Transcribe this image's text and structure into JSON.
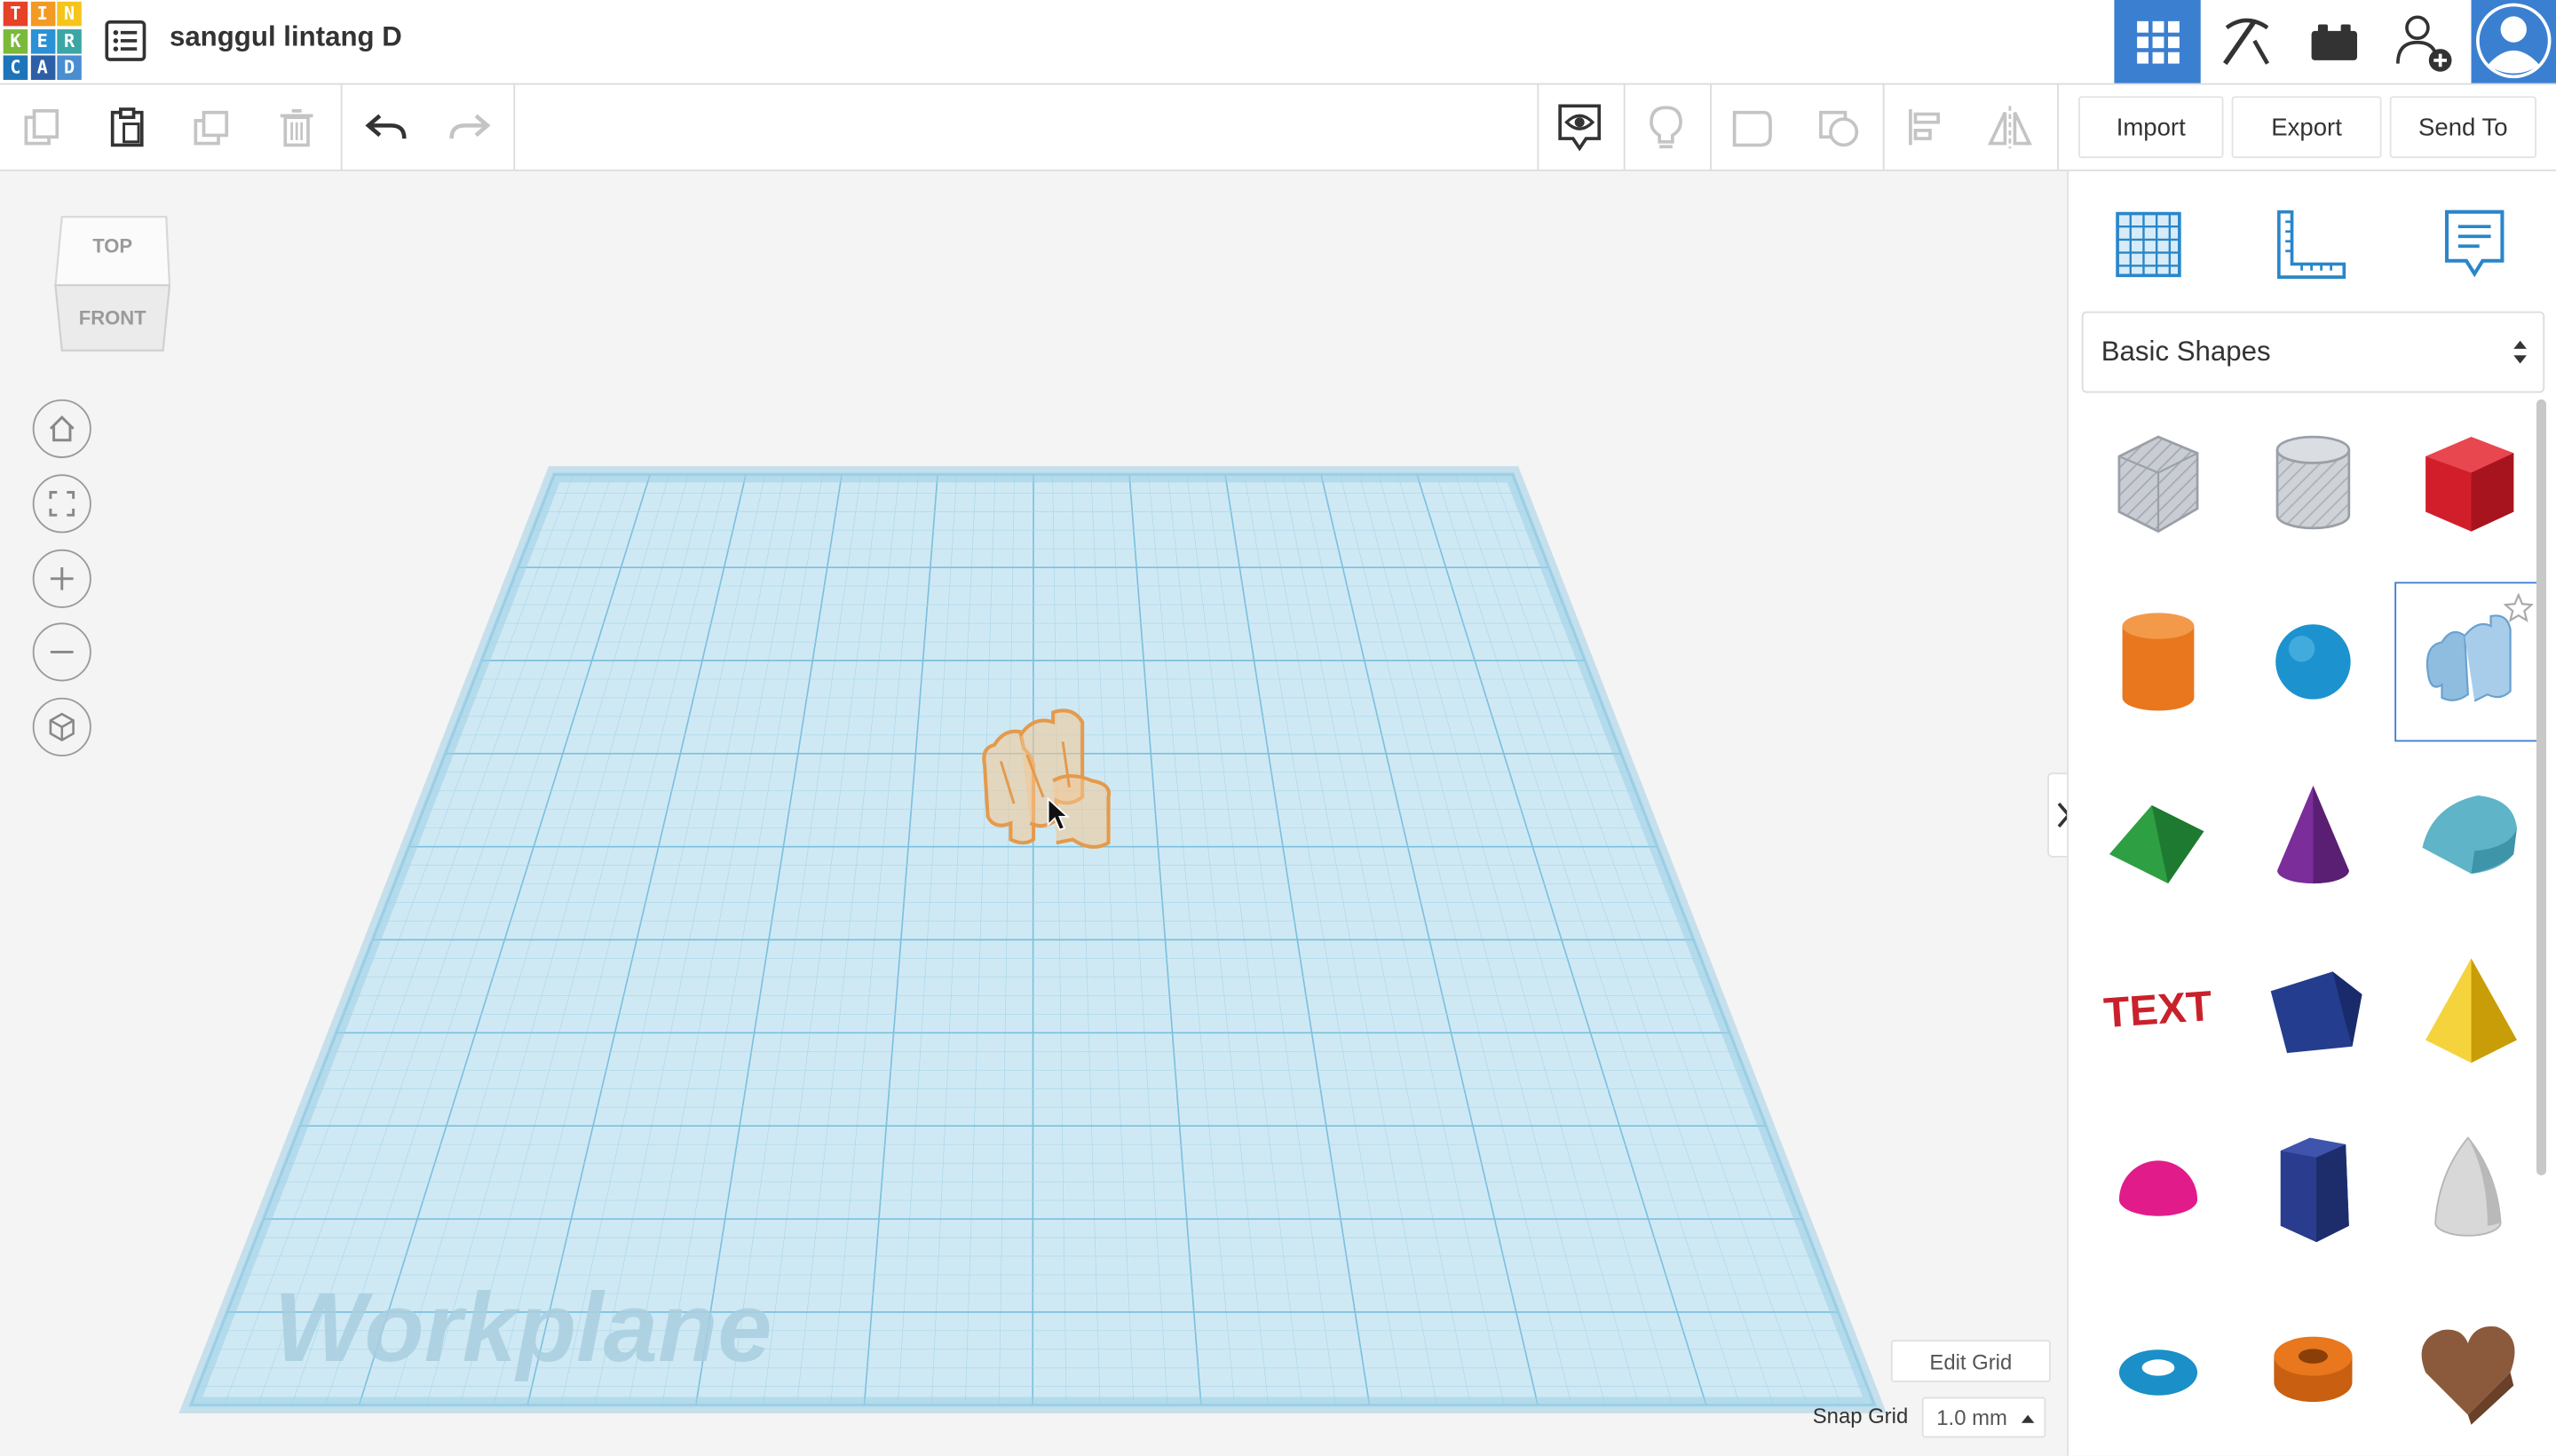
{
  "app": {
    "logo_letters": [
      "T",
      "I",
      "N",
      "K",
      "E",
      "R",
      "C",
      "A",
      "D"
    ],
    "logo_colors": [
      "#e8412a",
      "#f39a24",
      "#f5c51c",
      "#7bb93a",
      "#2a91d6",
      "#3aa6a5",
      "#1e74b8",
      "#2d5fa7",
      "#4a8dd1"
    ],
    "project_title": "sanggul lintang D"
  },
  "topbar": {
    "accent": "#3b7fd1",
    "icons": [
      "design-list-icon",
      "grid-view-icon",
      "pickaxe-icon",
      "bricks-icon",
      "add-user-icon",
      "avatar"
    ]
  },
  "toolbar": {
    "import_label": "Import",
    "export_label": "Export",
    "sendto_label": "Send To"
  },
  "viewcube": {
    "top_label": "TOP",
    "front_label": "FRONT"
  },
  "workplane": {
    "watermark": "Workplane",
    "grid_color": "#a8d6ea",
    "edit_grid_label": "Edit Grid",
    "snap_grid_label": "Snap Grid",
    "snap_grid_value": "1.0 mm"
  },
  "panel": {
    "category_selected": "Basic Shapes",
    "shapes": [
      {
        "name": "box-hole",
        "color": "#b9bec6"
      },
      {
        "name": "cylinder-hole",
        "color": "#c0c4ca"
      },
      {
        "name": "box",
        "color": "#d21e2b"
      },
      {
        "name": "cylinder",
        "color": "#e8771d"
      },
      {
        "name": "sphere",
        "color": "#1c93cf"
      },
      {
        "name": "scribble",
        "color": "#8fbde0"
      },
      {
        "name": "roof",
        "color": "#2ea043"
      },
      {
        "name": "cone",
        "color": "#7b2d9a"
      },
      {
        "name": "round-roof",
        "color": "#5fb4c7"
      },
      {
        "name": "text",
        "color": "#c9212c"
      },
      {
        "name": "polygon",
        "color": "#243d8f"
      },
      {
        "name": "pyramid",
        "color": "#f1c40f"
      },
      {
        "name": "half-sphere",
        "color": "#e11c8a"
      },
      {
        "name": "hexagonal-prism",
        "color": "#2a3c8e"
      },
      {
        "name": "paraboloid",
        "color": "#d8d8d8"
      },
      {
        "name": "torus",
        "color": "#1b8fc8"
      },
      {
        "name": "tube",
        "color": "#e8771d"
      },
      {
        "name": "heart",
        "color": "#8b5a3c"
      }
    ],
    "text_shape_label": "TEXT"
  }
}
